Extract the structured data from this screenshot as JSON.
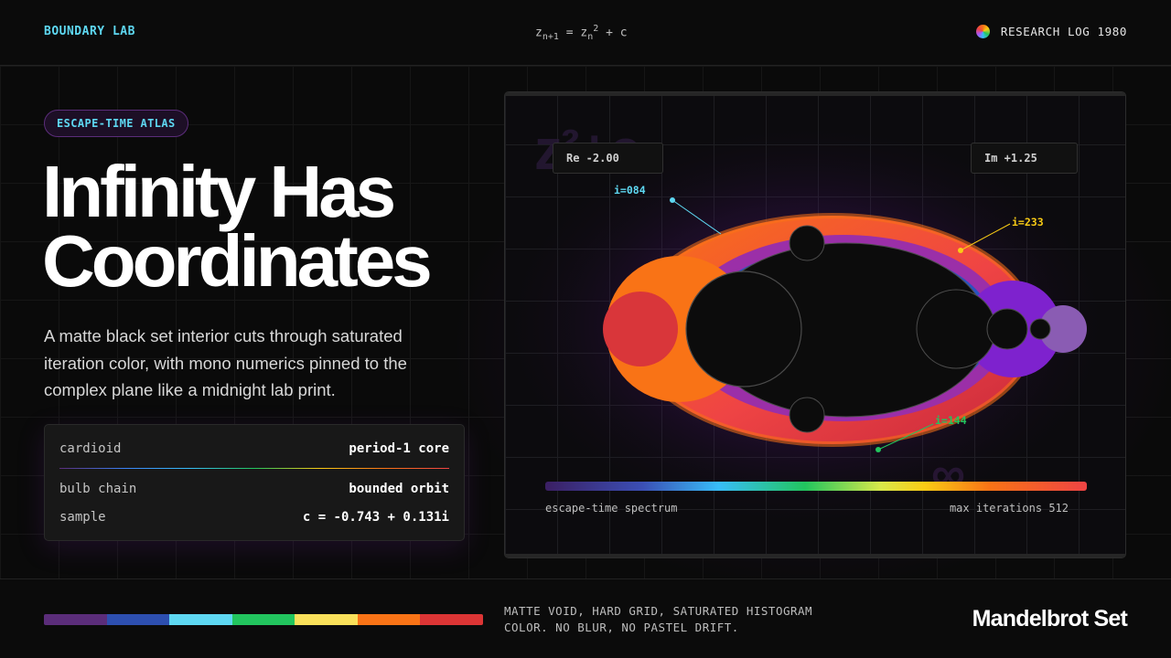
{
  "header": {
    "brand": "BOUNDARY LAB",
    "formula": {
      "z1": "z",
      "sub1": "n+1",
      "eq": " = ",
      "z2": "z",
      "sub2": "n",
      "sup2": "2",
      "tail": " + c"
    },
    "log_label": "RESEARCH LOG 1980",
    "log_icon": "spectrum-dot-icon"
  },
  "hero": {
    "badge": "ESCAPE-TIME ATLAS",
    "title_line1": "Infinity Has",
    "title_line2": "Coordinates",
    "lede": "A matte black set interior cuts through saturated iteration color, with mono numerics pinned to the complex plane like a midnight lab print."
  },
  "spec_card": {
    "rows": [
      {
        "key": "cardioid",
        "value": "period-1 core"
      },
      {
        "key": "bulb chain",
        "value": "bounded orbit"
      },
      {
        "key": "sample",
        "value": "c = -0.743 + 0.131i"
      }
    ]
  },
  "figure": {
    "ghost_formula": "z²+c",
    "ghost_infinity": "∞",
    "coord_re": "Re -2.00",
    "coord_im": "Im +1.25",
    "probes": [
      {
        "label": "i=084",
        "color": "#5ed8f2"
      },
      {
        "label": "i=233",
        "color": "#facc15"
      },
      {
        "label": "i=144",
        "color": "#22c55e"
      }
    ],
    "spectrum_label": "escape-time spectrum",
    "max_iterations": "max iterations 512"
  },
  "footer": {
    "palette": [
      "#5b2d7a",
      "#2d4fb0",
      "#5ed8f2",
      "#22c55e",
      "#f9e05a",
      "#f97316",
      "#dc3535"
    ],
    "note_line1": "MATTE VOID, HARD GRID, SATURATED HISTOGRAM",
    "note_line2": "COLOR. NO BLUR, NO PASTEL DRIFT.",
    "title": "Mandelbrot Set"
  },
  "colors": {
    "accent_cyan": "#5ed8f2",
    "background": "#0a0a0a",
    "badge_border": "#5b2d7a"
  }
}
